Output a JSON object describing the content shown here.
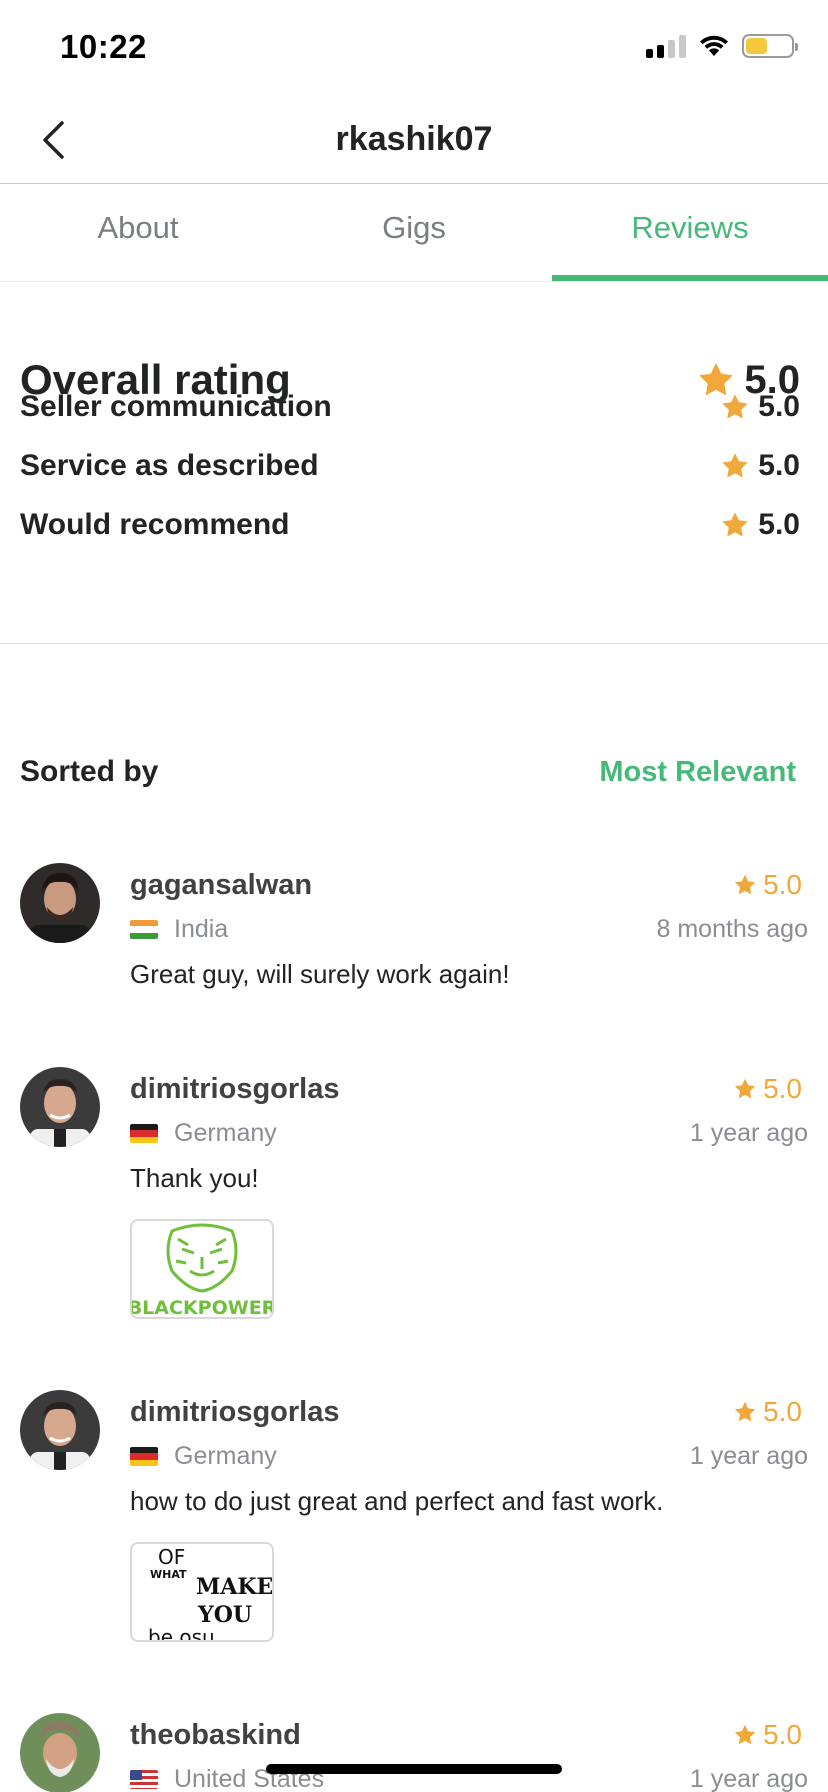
{
  "status_bar": {
    "time": "10:22"
  },
  "header": {
    "title": "rkashik07"
  },
  "tabs": [
    {
      "label": "About",
      "active": false
    },
    {
      "label": "Gigs",
      "active": false
    },
    {
      "label": "Reviews",
      "active": true
    }
  ],
  "ratings": {
    "overall_label": "Overall rating",
    "overall_value": "5.0",
    "items": [
      {
        "label": "Seller communication",
        "value": "5.0"
      },
      {
        "label": "Service as described",
        "value": "5.0"
      },
      {
        "label": "Would recommend",
        "value": "5.0"
      }
    ]
  },
  "sort": {
    "label": "Sorted by",
    "value": "Most Relevant"
  },
  "reviews": [
    {
      "username": "gagansalwan",
      "rating": "5.0",
      "country": "India",
      "time": "8 months ago",
      "text": "Great guy, will surely work again!"
    },
    {
      "username": "dimitriosgorlas",
      "rating": "5.0",
      "country": "Germany",
      "time": "1 year ago",
      "text": "Thank you!",
      "attachment_text": "BLACKPOWER"
    },
    {
      "username": "dimitriosgorlas",
      "rating": "5.0",
      "country": "Germany",
      "time": "1 year ago",
      "text": "how to do just great and perfect and fast work.",
      "attachment_text": [
        "OF",
        "WHAT",
        "MAKE",
        "YOU",
        "be osu"
      ]
    },
    {
      "username": "theobaskind",
      "rating": "5.0",
      "country": "United States",
      "time": "1 year ago"
    }
  ],
  "colors": {
    "accent_green": "#46b978",
    "star": "#f1a83b",
    "battery": "#f5c93d"
  }
}
